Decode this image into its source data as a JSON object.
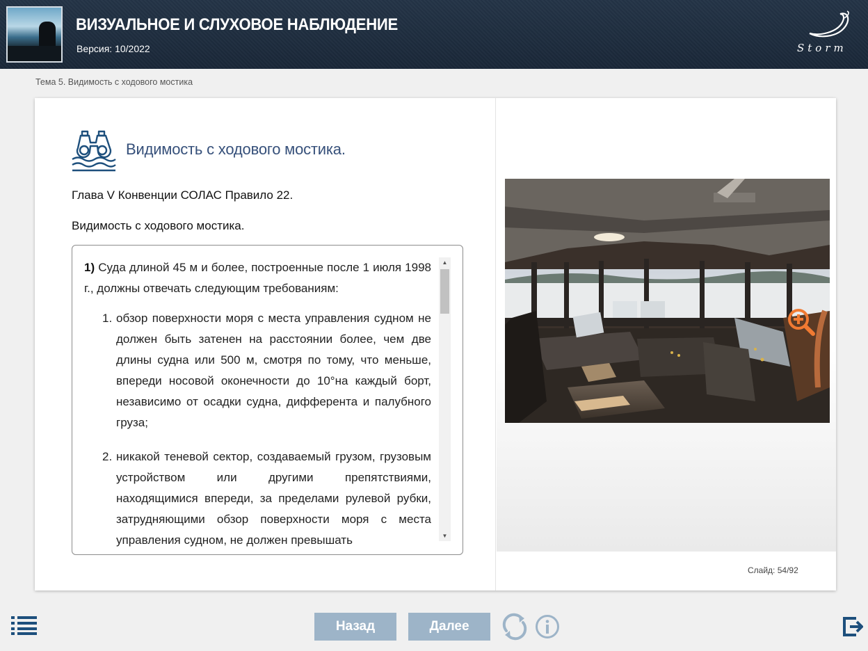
{
  "header": {
    "title": "ВИЗУАЛЬНОЕ И СЛУХОВОЕ НАБЛЮДЕНИЕ",
    "version": "Версия: 10/2022",
    "logo_text": "Storm"
  },
  "breadcrumb": "Тема 5. Видимость с ходового мостика",
  "slide": {
    "title": "Видимость с ходового мостика.",
    "paragraph1": "Глава V Конвенции СОЛАС Правило 22.",
    "paragraph2": "Видимость с ходового мостика.",
    "scroll": {
      "intro_number": "1)",
      "intro_text": "Суда длиной 45 м и более, построенные после 1 июля 1998 г., должны отвечать следующим требованиям:",
      "items": [
        {
          "num": "1.",
          "text": "обзор поверхности моря с места управления судном не должен быть затенен на расстоянии более, чем две длины судна или 500 м, смотря по тому, что меньше, впереди носовой оконечности до 10°на каждый борт, независимо от осадки судна, дифферента и палубного груза;"
        },
        {
          "num": "2.",
          "text": "никакой теневой сектор, создаваемый грузом, грузовым устройством или другими препятствиями, находящимися впереди, за пределами рулевой рубки, затрудняющими обзор поверхности моря с места управления судном, не должен превышать"
        }
      ]
    },
    "counter": "Слайд:  54/92"
  },
  "icons": {
    "title_icon": "binoculars-waves-icon",
    "zoom": "zoom-in-icon",
    "menu": "menu-list-icon",
    "reload": "reload-icon",
    "info": "info-icon",
    "exit": "exit-icon"
  },
  "colors": {
    "header_bg": "#1f2d3f",
    "title_blue": "#36507a",
    "button_bg": "#9db4c8",
    "zoom_orange": "#f07a32",
    "icon_blue": "#1d4f7c"
  },
  "nav": {
    "back_label": "Назад",
    "next_label": "Далее"
  }
}
